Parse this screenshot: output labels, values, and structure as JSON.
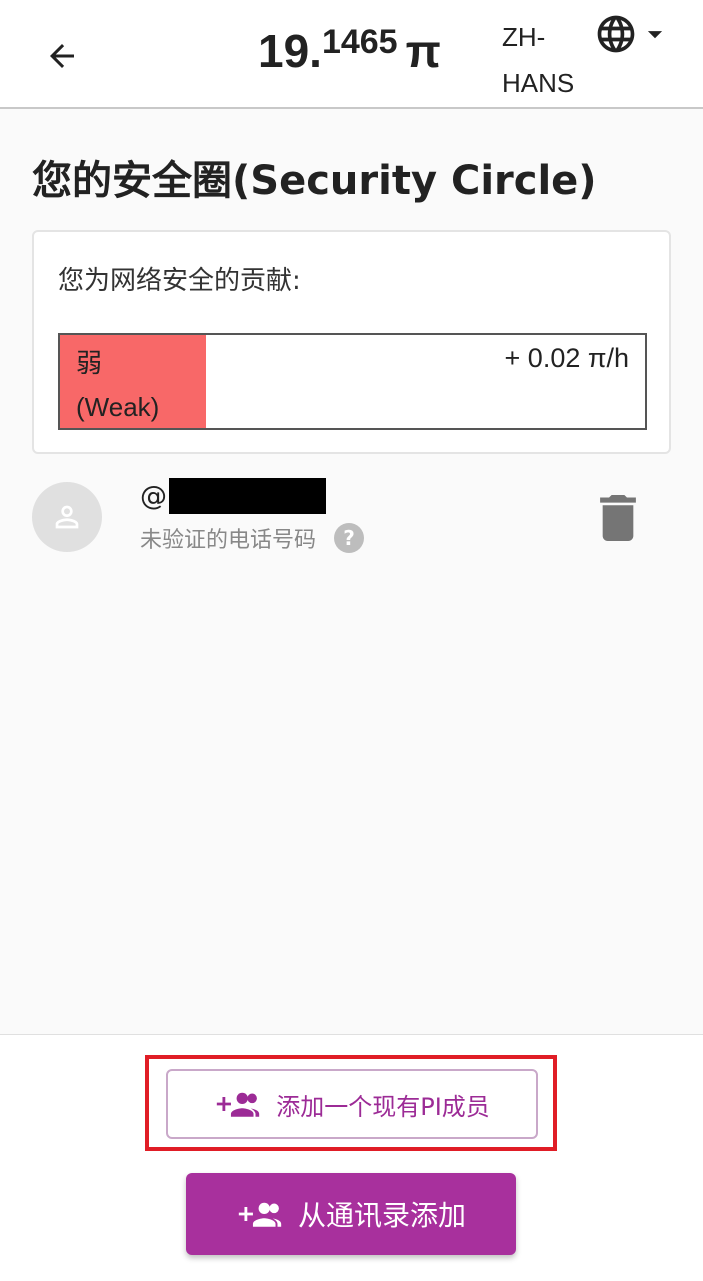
{
  "header": {
    "back_icon": "arrow-left-icon",
    "balance_integer": "19.",
    "balance_fraction": "1465",
    "balance_unit": "π",
    "language": "ZH-\nHANS",
    "language_icon": "globe-icon",
    "language_dropdown_icon": "caret-down-icon"
  },
  "page": {
    "title": "您的安全圈(Security Circle)"
  },
  "contribution": {
    "label": "您为网络安全的贡献:",
    "level": "弱\n(Weak)",
    "rate": "+ 0.02 π/h",
    "level_fraction": 0.25,
    "level_color": "#f86868"
  },
  "members": [
    {
      "username_prefix": "@",
      "username_redacted": true,
      "status": "未验证的电话号码",
      "avatar_icon": "person-icon",
      "help_icon": "question-icon",
      "delete_icon": "trash-icon"
    }
  ],
  "actions": {
    "add_existing_label": "添加一个现有PI成员",
    "add_contacts_label": "从通讯录添加",
    "add_icon": "add-group-icon",
    "accent_color": "#a8309d",
    "highlight_color": "#e01d26"
  },
  "help_glyph": "?"
}
